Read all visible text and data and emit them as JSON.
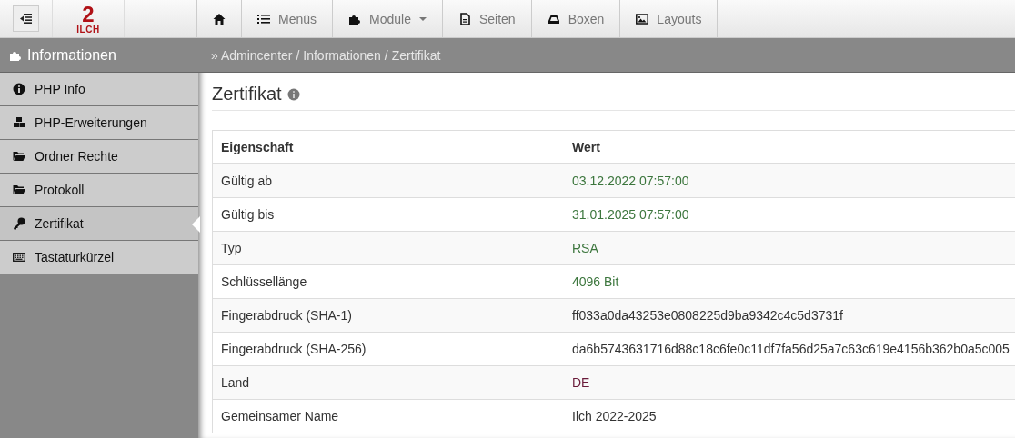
{
  "logo": {
    "mark": "2",
    "name": "ILCH"
  },
  "nav": [
    {
      "dropdown": false
    },
    {
      "label": "Menüs",
      "dropdown": false
    },
    {
      "label": "Module",
      "dropdown": true
    },
    {
      "label": "Seiten",
      "dropdown": false
    },
    {
      "label": "Boxen",
      "dropdown": false
    },
    {
      "label": "Layouts",
      "dropdown": false
    }
  ],
  "sidebar": {
    "title": "Informationen",
    "items": [
      {
        "label": "PHP Info",
        "selected": false
      },
      {
        "label": "PHP-Erweiterungen",
        "selected": false
      },
      {
        "label": "Ordner Rechte",
        "selected": false
      },
      {
        "label": "Protokoll",
        "selected": false
      },
      {
        "label": "Zertifikat",
        "selected": true
      },
      {
        "label": "Tastaturkürzel",
        "selected": false
      }
    ]
  },
  "breadcrumb": [
    "» Admincenter /",
    "Informationen /",
    "Zertifikat"
  ],
  "page_title": "Zertifikat",
  "table": {
    "columns": [
      "Eigenschaft",
      "Wert"
    ],
    "rows": [
      {
        "property": "Gültig ab",
        "value": "03.12.2022 07:57:00",
        "color": "#3c763d"
      },
      {
        "property": "Gültig bis",
        "value": "31.01.2025 07:57:00",
        "color": "#3c763d"
      },
      {
        "property": "Typ",
        "value": "RSA",
        "color": "#3c763d"
      },
      {
        "property": "Schlüssellänge",
        "value": "4096 Bit",
        "color": "#3c763d"
      },
      {
        "property": "Fingerabdruck (SHA-1)",
        "value": "ff033a0da43253e0808225d9ba9342c4c5d3731f",
        "color": "#333333"
      },
      {
        "property": "Fingerabdruck (SHA-256)",
        "value": "da6b5743631716d88c18c6fe0c11df7fa56d25a7c63c619e4156b362b0a5c005",
        "color": "#333333"
      },
      {
        "property": "Land",
        "value": "DE",
        "color": "#6a1b3a"
      },
      {
        "property": "Gemeinsamer Name",
        "value": "Ilch 2022-2025",
        "color": "#333333"
      }
    ]
  }
}
